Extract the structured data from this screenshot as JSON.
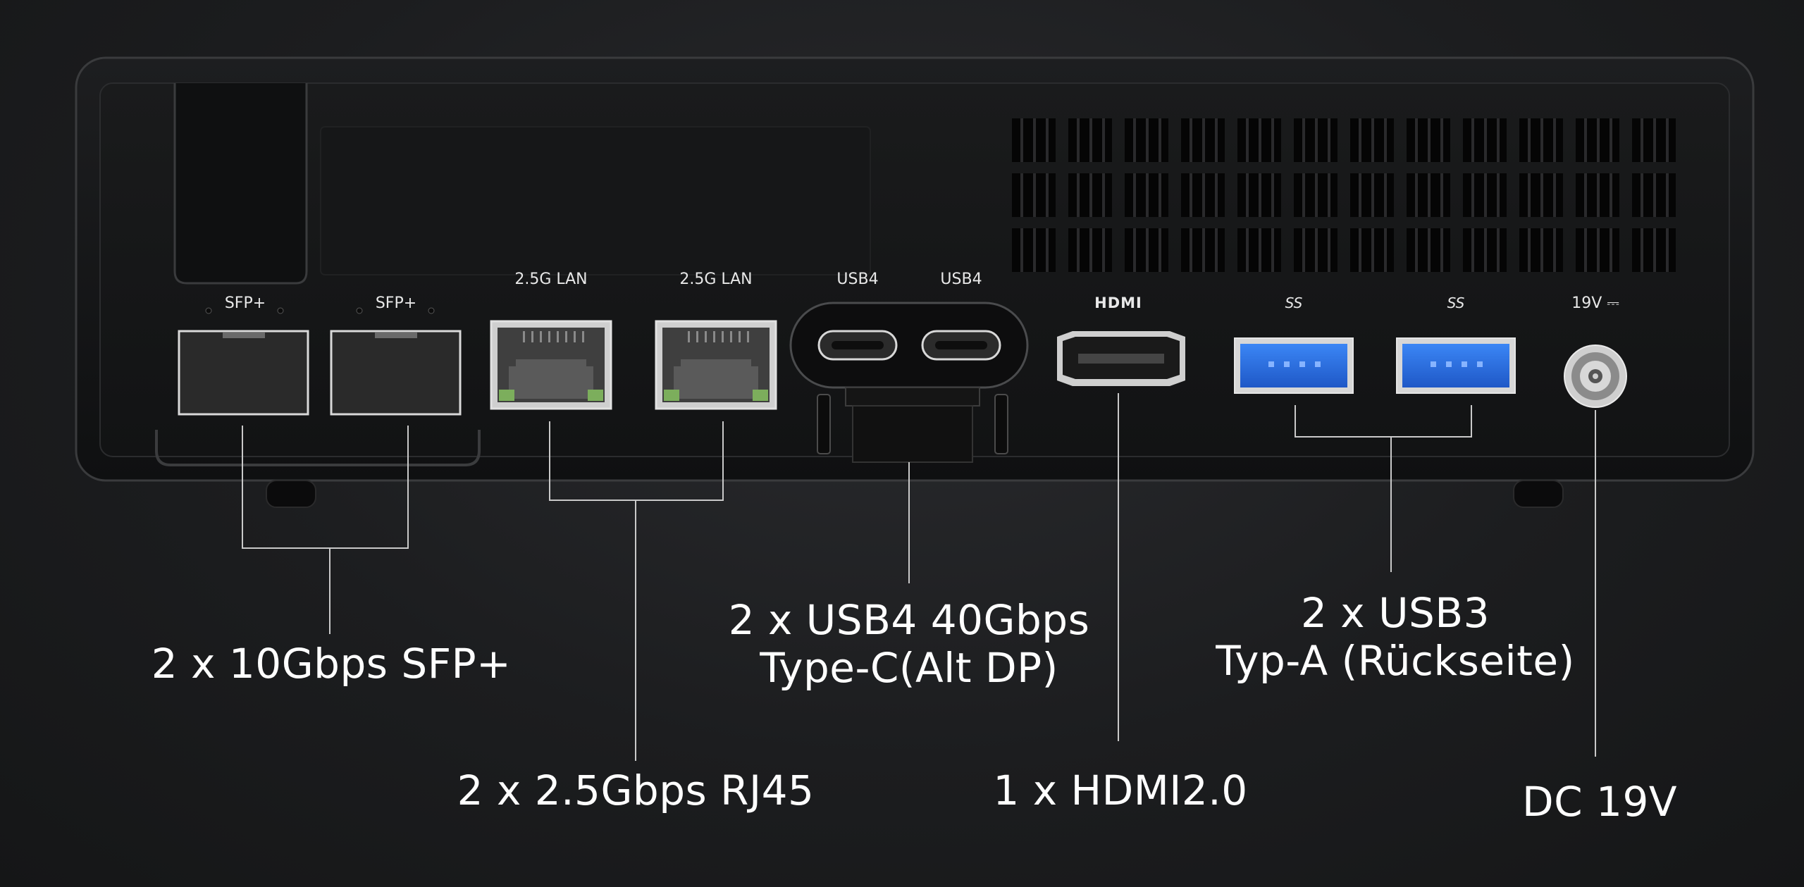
{
  "port_labels": {
    "sfp1": "SFP+",
    "sfp2": "SFP+",
    "lan1": "2.5G LAN",
    "lan2": "2.5G LAN",
    "usb4_1": "USB4",
    "usb4_2": "USB4",
    "hdmi": "HDMI",
    "ss1": "SS",
    "ss2": "SS",
    "dc": "19V ⎓"
  },
  "callouts": {
    "sfp": "2 x 10Gbps SFP+",
    "rj45": "2 x 2.5Gbps RJ45",
    "usb4_line1": "2 x USB4 40Gbps",
    "usb4_line2": "Type-C(Alt DP)",
    "hdmi": "1 x HDMI2.0",
    "usb3_line1": "2 x USB3",
    "usb3_line2": "Typ-A (Rückseite)",
    "dc": "DC 19V"
  },
  "colors": {
    "background": "#1c1d1f",
    "chassis": "#141414",
    "usb3_blue": "#2e6fe0",
    "lan_led_green": "#7cae5c",
    "leader_line": "#c9c9c9",
    "text": "#ffffff"
  }
}
